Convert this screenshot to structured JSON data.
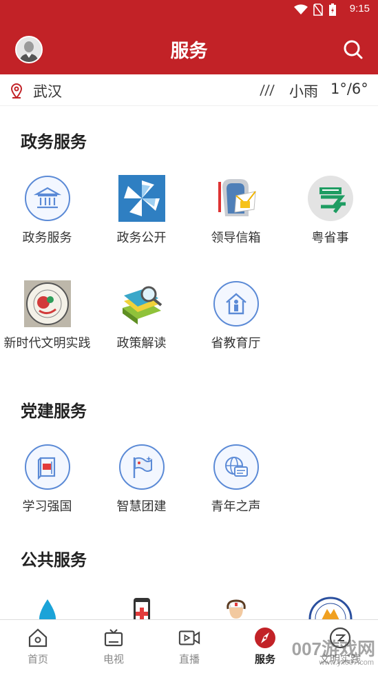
{
  "status_bar": {
    "time": "9:15"
  },
  "header": {
    "title": "服务"
  },
  "location": {
    "city": "武汉",
    "weather_desc": "小雨",
    "temperature": "1°/6°"
  },
  "sections": {
    "gov": {
      "title": "政务服务",
      "items": [
        {
          "label": "政务服务",
          "icon": "government-building-icon"
        },
        {
          "label": "政务公开",
          "icon": "pinwheel-icon"
        },
        {
          "label": "领导信箱",
          "icon": "mailbox-icon"
        },
        {
          "label": "粤省事",
          "icon": "yue-app-icon"
        },
        {
          "label": "新时代文明实践",
          "icon": "civilization-badge-icon"
        },
        {
          "label": "政策解读",
          "icon": "books-magnifier-icon"
        },
        {
          "label": "省教育厅",
          "icon": "education-house-icon"
        }
      ]
    },
    "party": {
      "title": "党建服务",
      "items": [
        {
          "label": "学习强国",
          "icon": "study-book-icon"
        },
        {
          "label": "智慧团建",
          "icon": "flag-icon"
        },
        {
          "label": "青年之声",
          "icon": "globe-chat-icon"
        }
      ]
    },
    "public": {
      "title": "公共服务",
      "items": [
        {
          "icon": "water-drop-icon"
        },
        {
          "icon": "medical-phone-icon"
        },
        {
          "icon": "nurse-icon"
        },
        {
          "icon": "emblem-badge-icon"
        }
      ]
    }
  },
  "bottom_nav": [
    {
      "label": "首页",
      "icon": "home-icon",
      "active": false
    },
    {
      "label": "电视",
      "icon": "tv-icon",
      "active": false
    },
    {
      "label": "直播",
      "icon": "live-video-icon",
      "active": false
    },
    {
      "label": "服务",
      "icon": "compass-icon",
      "active": true
    },
    {
      "label": "文明实践",
      "icon": "practice-icon",
      "active": false
    }
  ],
  "watermark": {
    "text": "007游戏网",
    "sub": "www.yx007.com"
  },
  "colors": {
    "brand_red": "#c22227",
    "icon_blue": "#5b8ad6"
  }
}
